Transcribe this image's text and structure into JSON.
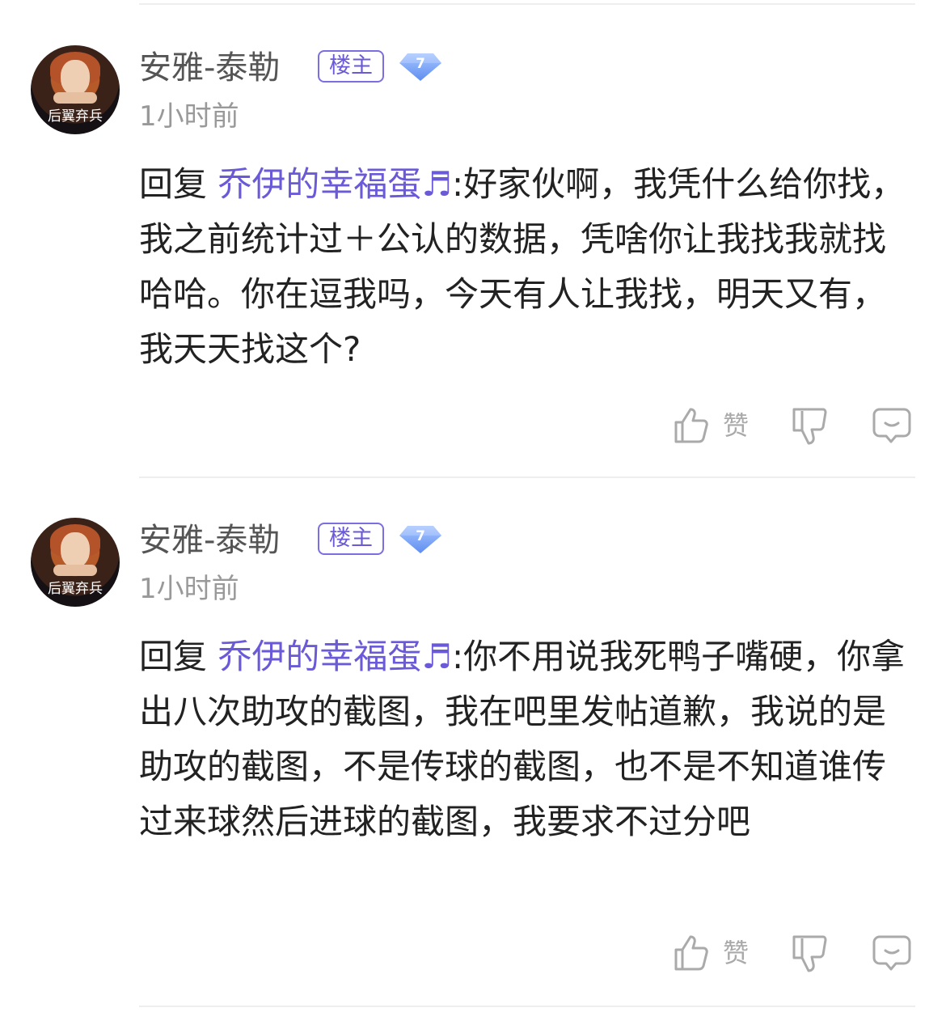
{
  "comments": [
    {
      "username": "安雅-泰勒",
      "owner_badge": "楼主",
      "level": "7",
      "time": "1小时前",
      "avatar_text": "后翼弃兵",
      "reply_prefix": "回复",
      "reply_target": "乔伊的幸福蛋♬",
      "content": ":好家伙啊，我凭什么给你找，我之前统计过＋公认的数据，凭啥你让我找我就找哈哈。你在逗我吗，今天有人让我找，明天又有，我天天找这个?",
      "like_label": "赞"
    },
    {
      "username": "安雅-泰勒",
      "owner_badge": "楼主",
      "level": "7",
      "time": "1小时前",
      "avatar_text": "后翼弃兵",
      "reply_prefix": "回复",
      "reply_target": "乔伊的幸福蛋♬",
      "content": ":你不用说我死鸭子嘴硬，你拿出八次助攻的截图，我在吧里发帖道歉，我说的是助攻的截图，不是传球的截图，也不是不知道谁传过来球然后进球的截图，我要求不过分吧",
      "like_label": "赞"
    }
  ],
  "colors": {
    "accent": "#6a5ad8",
    "username": "#555555",
    "meta": "#999999",
    "level_badge": "#7fa8f5"
  },
  "icons": {
    "like": "thumbs-up-icon",
    "dislike": "thumbs-down-icon",
    "reply": "comment-bubble-icon",
    "level": "diamond-level-icon"
  }
}
